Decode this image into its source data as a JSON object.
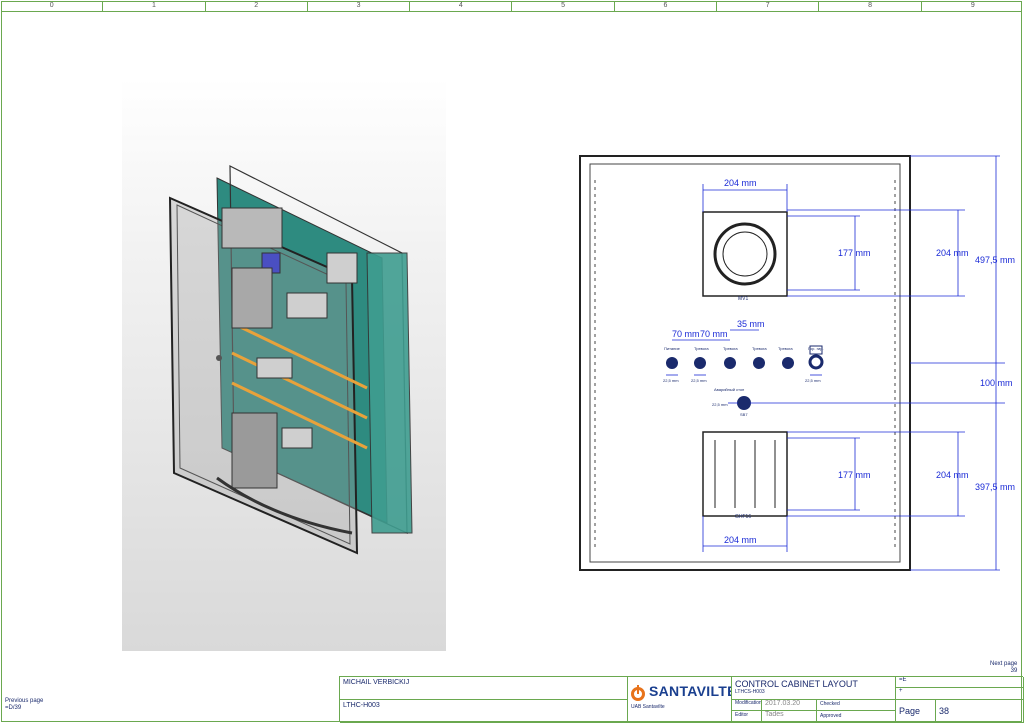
{
  "ruler": {
    "columns": [
      "0",
      "1",
      "2",
      "3",
      "4",
      "5",
      "6",
      "7",
      "8",
      "9"
    ]
  },
  "layout_view": {
    "dimensions": {
      "fan_width": "204 mm",
      "fan_inner": "177 mm",
      "fan_height": "204 mm",
      "fan_offset": "497,5 mm",
      "spacing_1": "70 mm",
      "spacing_2": "70 mm",
      "spacing_3": "35 mm",
      "mid_offset": "100 mm",
      "filter_inner": "177 mm",
      "filter_height": "204 mm",
      "filter_offset": "397,5 mm",
      "filter_width": "204 mm",
      "button_dia_1": "22,5 mm",
      "button_dia_2": "22,5 mm",
      "button_dia_3": "22,5 mm",
      "button_dia_4": "22,5 mm"
    },
    "component_tags": {
      "fan": "MV1",
      "filter": "GHF16",
      "estop": "SB7"
    },
    "button_labels": [
      "Питание",
      "Тревога",
      "Тревога",
      "Тревога",
      "Тревога",
      "Гор. гир."
    ],
    "estop_label": "Аварийный стоп"
  },
  "title_block": {
    "author": "MICHAIL VERBICKIJ",
    "project_code": "LTHC-H003",
    "company_logo": "SANTAVILTE",
    "company_name": "UAB Santavilte",
    "doc_title": "CONTROL CABINET LAYOUT",
    "doc_code": "LTHCS-H003",
    "modification_label": "Modification",
    "modification_date": "2017.03.20",
    "editor_label": "Editor",
    "editor_name": "Tades",
    "checked_label": "Checked",
    "approved_label": "Approved",
    "field_e": "=E",
    "field_plus": "+",
    "page_label": "Page",
    "page_number": "38"
  },
  "navigation": {
    "previous_label": "Previous page",
    "previous_value": "=D/39",
    "next_label": "Next page",
    "next_value": "39"
  }
}
